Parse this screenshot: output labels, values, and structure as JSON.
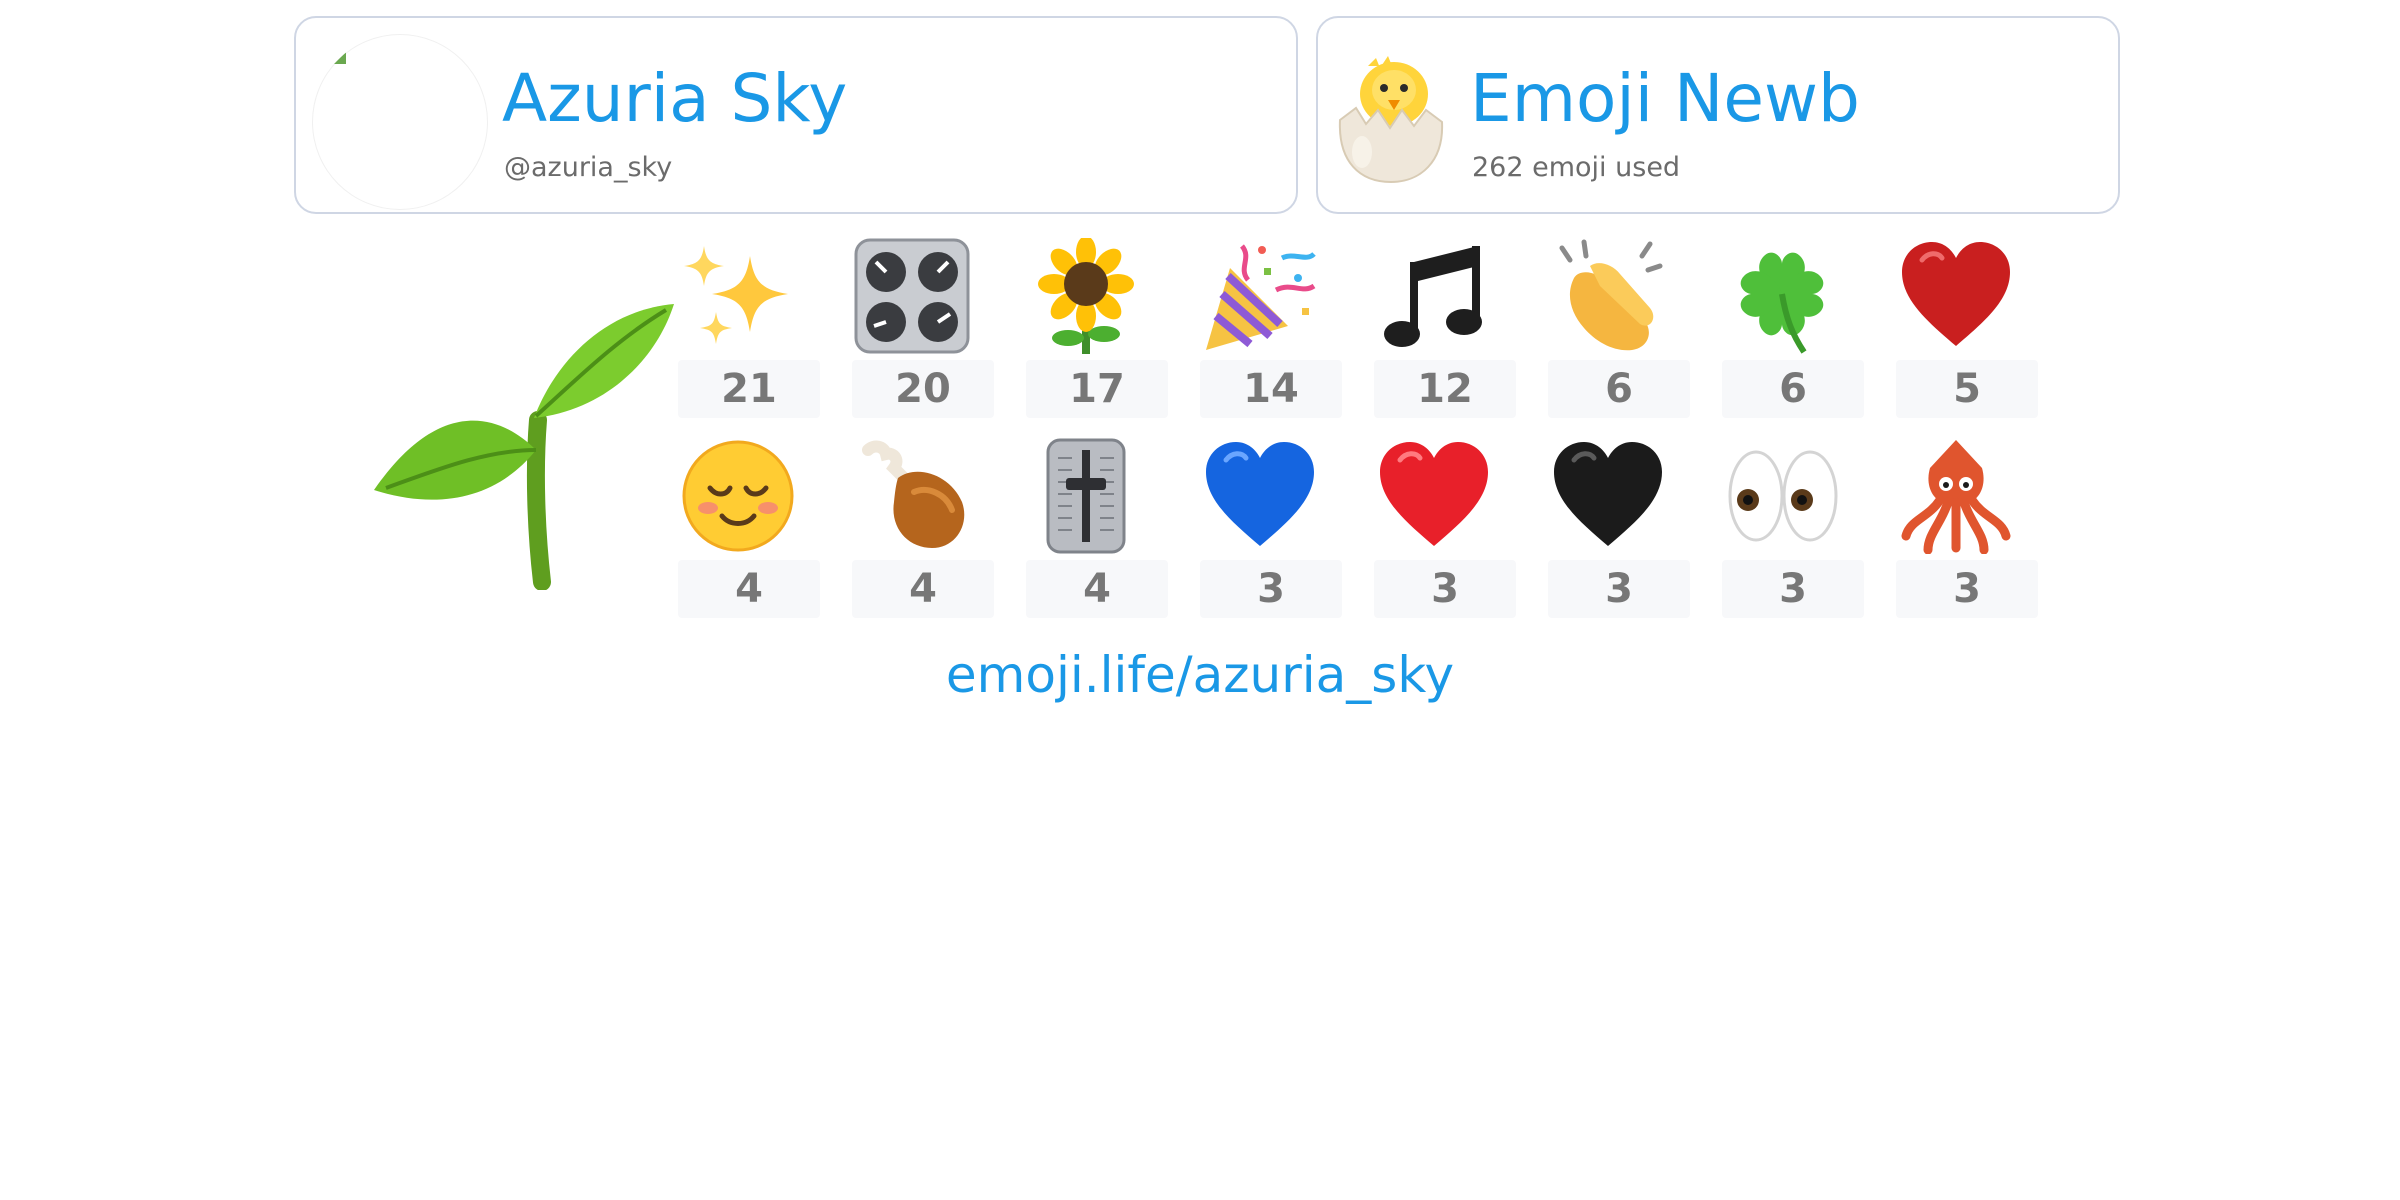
{
  "profile": {
    "display_name": "Azuria Sky",
    "handle": "@azuria_sky",
    "avatar_icon": "broken-image-icon"
  },
  "rank": {
    "title": "Emoji Newb",
    "subtitle": "262 emoji used",
    "badge_icon": "hatching-chick-icon"
  },
  "level_icon": "seedling-icon",
  "top_emoji": [
    {
      "icon": "sparkles-icon",
      "count": "21"
    },
    {
      "icon": "control-knobs-icon",
      "count": "20"
    },
    {
      "icon": "sunflower-icon",
      "count": "17"
    },
    {
      "icon": "party-popper-icon",
      "count": "14"
    },
    {
      "icon": "musical-note-icon",
      "count": "12"
    },
    {
      "icon": "clapping-hands-icon",
      "count": "6"
    },
    {
      "icon": "four-leaf-clover-icon",
      "count": "6"
    },
    {
      "icon": "red-heart-suit-icon",
      "count": "5"
    },
    {
      "icon": "smiling-face-icon",
      "count": "4"
    },
    {
      "icon": "poultry-leg-icon",
      "count": "4"
    },
    {
      "icon": "level-slider-icon",
      "count": "4"
    },
    {
      "icon": "blue-heart-icon",
      "count": "3"
    },
    {
      "icon": "red-heart-icon",
      "count": "3"
    },
    {
      "icon": "black-heart-icon",
      "count": "3"
    },
    {
      "icon": "eyes-icon",
      "count": "3"
    },
    {
      "icon": "squid-icon",
      "count": "3"
    }
  ],
  "footer": {
    "link_text": "emoji.life/azuria_sky"
  },
  "colors": {
    "accent": "#1a98e6",
    "card_border": "#cfd6e4",
    "count_bg": "#f7f8fa",
    "count_text": "#777777",
    "subtitle_text": "#6b6b6b"
  }
}
